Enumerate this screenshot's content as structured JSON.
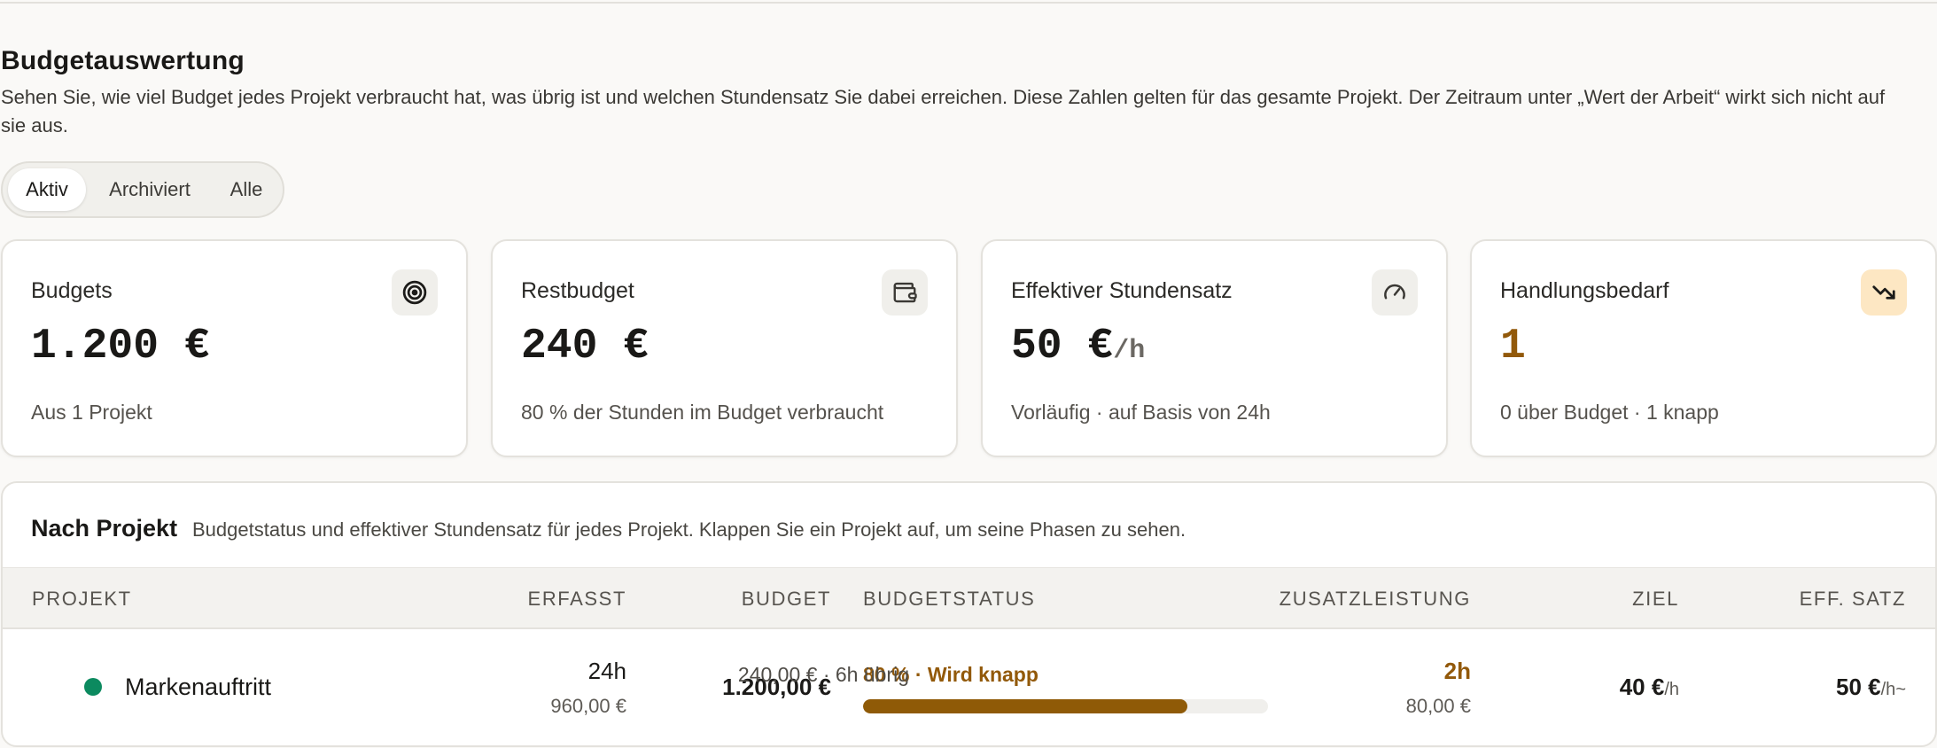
{
  "page": {
    "title": "Budgetauswertung",
    "description": "Sehen Sie, wie viel Budget jedes Projekt verbraucht hat, was übrig ist und welchen Stundensatz Sie dabei erreichen. Diese Zahlen gelten für das gesamte Projekt. Der Zeitraum unter „Wert der Arbeit“ wirkt sich nicht auf sie aus."
  },
  "filter": {
    "options": [
      "Aktiv",
      "Archiviert",
      "Alle"
    ],
    "selected": "Aktiv"
  },
  "cards": [
    {
      "label": "Budgets",
      "value": "1.200 €",
      "unit": "",
      "footnote": "Aus 1 Projekt",
      "icon": "target-icon"
    },
    {
      "label": "Restbudget",
      "value": "240 €",
      "unit": "",
      "footnote": "80 % der Stunden im Budget verbraucht",
      "icon": "wallet-icon"
    },
    {
      "label": "Effektiver Stundensatz",
      "value": "50 €",
      "unit": "/h",
      "footnote": "Vorläufig · auf Basis von 24h",
      "icon": "gauge-icon"
    },
    {
      "label": "Handlungsbedarf",
      "value": "1",
      "unit": "",
      "footnote": "0 über Budget · 1 knapp",
      "icon": "trend-down-icon",
      "accent": "#92590a"
    }
  ],
  "table": {
    "title": "Nach Projekt",
    "subtitle": "Budgetstatus und effektiver Stundensatz für jedes Projekt. Klappen Sie ein Projekt auf, um seine Phasen zu sehen.",
    "headers": {
      "project": "PROJEKT",
      "logged": "ERFASST",
      "budget": "BUDGET",
      "status": "BUDGETSTATUS",
      "extra": "ZUSATZLEISTUNG",
      "target": "ZIEL",
      "rate": "EFF. SATZ"
    },
    "rows": [
      {
        "name": "Markenauftritt",
        "status_color": "#0c8a5f",
        "logged_hours": "24h",
        "logged_amount": "960,00 €",
        "budget": "1.200,00 €",
        "status_label": "80 % · Wird knapp",
        "status_rest": "240,00 € · 6h übrig",
        "progress_percent": 80,
        "extra_hours": "2h",
        "extra_amount": "80,00 €",
        "target": "40 €",
        "target_unit": "/h",
        "rate": "50 €",
        "rate_unit": "/h",
        "rate_suffix": "~"
      }
    ]
  },
  "colors": {
    "warning": "#92590a",
    "progress": "#8f5a07",
    "ok_dot": "#0c8a5f"
  }
}
